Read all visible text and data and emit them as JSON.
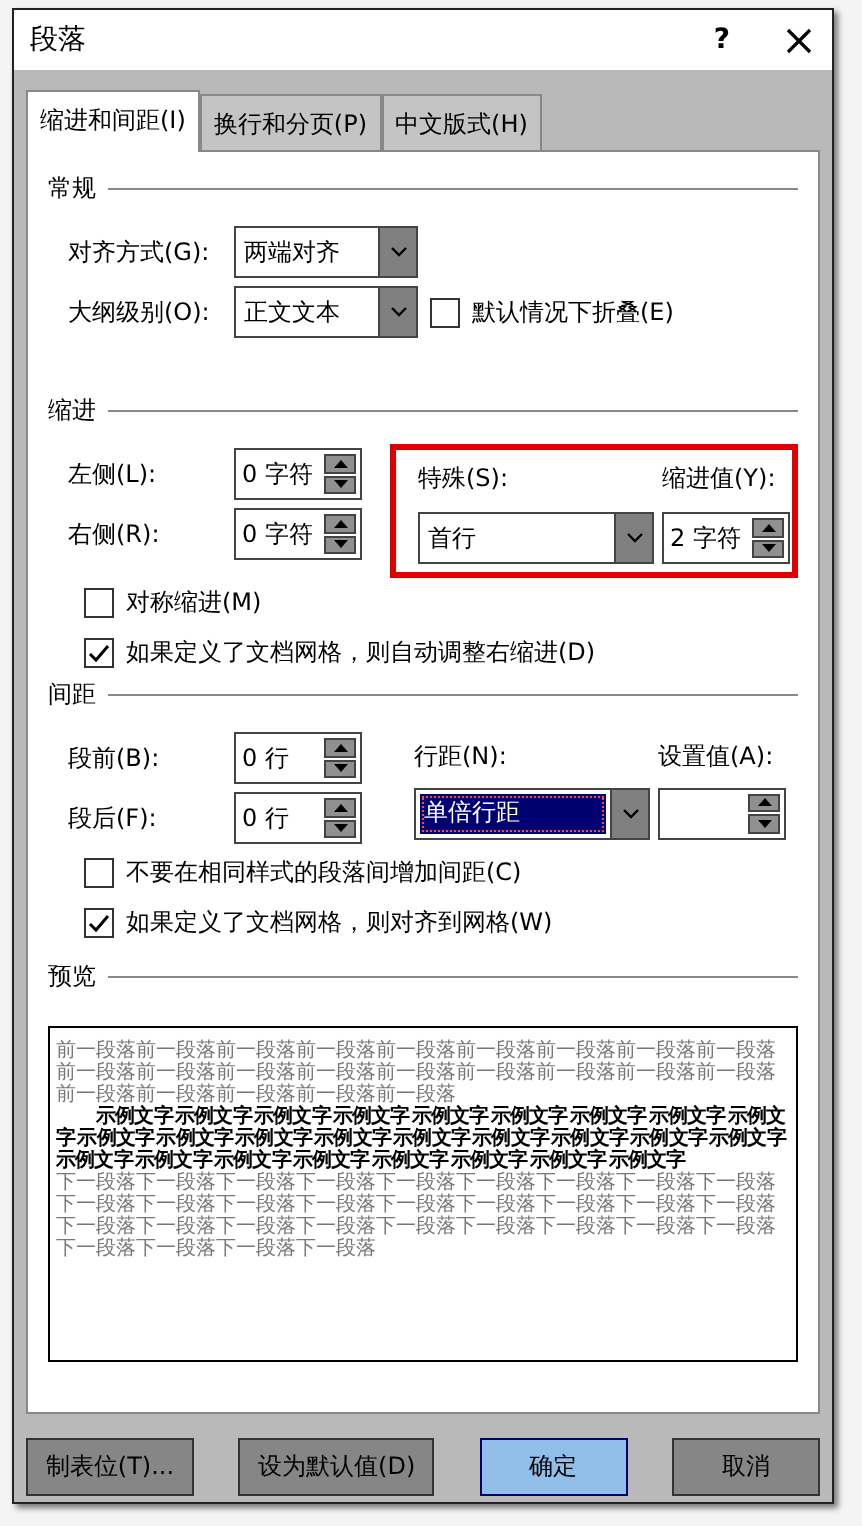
{
  "window": {
    "title": "段落",
    "help": "?"
  },
  "tabs": [
    {
      "label": "缩进和间距(I)",
      "selected": true
    },
    {
      "label": "换行和分页(P)",
      "selected": false
    },
    {
      "label": "中文版式(H)",
      "selected": false
    }
  ],
  "general": {
    "title": "常规",
    "alignment": {
      "label": "对齐方式(G):",
      "value": "两端对齐"
    },
    "outline_level": {
      "label": "大纲级别(O):",
      "value": "正文文本"
    },
    "collapse": {
      "label": "默认情况下折叠(E)",
      "checked": false
    }
  },
  "indent": {
    "title": "缩进",
    "left": {
      "label": "左侧(L):",
      "value": "0 字符"
    },
    "right": {
      "label": "右侧(R):",
      "value": "0 字符"
    },
    "special": {
      "label": "特殊(S):",
      "value": "首行",
      "focused": false
    },
    "by": {
      "label": "缩进值(Y):",
      "value": "2 字符"
    },
    "mirror": {
      "label": "对称缩进(M)",
      "checked": false
    },
    "auto_adjust": {
      "label": "如果定义了文档网格，则自动调整右缩进(D)",
      "checked": true
    }
  },
  "spacing": {
    "title": "间距",
    "before": {
      "label": "段前(B):",
      "value": "0 行"
    },
    "after": {
      "label": "段后(F):",
      "value": "0 行"
    },
    "line_spacing": {
      "label": "行距(N):",
      "value": "单倍行距",
      "focused": true
    },
    "at": {
      "label": "设置值(A):"
    },
    "dont_add": {
      "label": "不要在相同样式的段落间增加间距(C)",
      "checked": false
    },
    "snap": {
      "label": "如果定义了文档网格，则对齐到网格(W)",
      "checked": true
    }
  },
  "preview": {
    "title": "预览",
    "previous": "前一段落前一段落前一段落前一段落前一段落前一段落前一段落前一段落前一段落前一段落前一段落前一段落前一段落前一段落前一段落前一段落前一段落前一段落前一段落前一段落前一段落前一段落前一段落",
    "sample_lines": [
      "示例文字 示例文字 示例文字 示例文字 示例文字 示例文字 示例文字 示例文字 示例文",
      "字 示例文字 示例文字 示例文字 示例文字 示例文字 示例文字 示例文字 示例文字 示例文字",
      "示例文字 示例文字 示例文字 示例文字 示例文字 示例文字 示例文字 示例文字"
    ],
    "next": "下一段落下一段落下一段落下一段落下一段落下一段落下一段落下一段落下一段落下一段落下一段落下一段落下一段落下一段落下一段落下一段落下一段落下一段落下一段落下一段落下一段落下一段落下一段落下一段落下一段落下一段落下一段落下一段落下一段落下一段落下一段落"
  },
  "buttons": [
    {
      "label": "制表位(T)...",
      "default": false
    },
    {
      "label": "设为默认值(D)",
      "default": false
    },
    {
      "label": "确定",
      "default": true
    },
    {
      "label": "取消",
      "default": false
    }
  ]
}
